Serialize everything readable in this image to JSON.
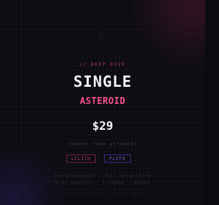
{
  "decor": {
    "moon_glyph": "☾"
  },
  "product": {
    "eyebrow": "// DEEP DIVE",
    "title": "SINGLE",
    "subtitle": "ASTEROID",
    "price": "$29",
    "choose_label": "CHOOSE YOUR ASTEROID",
    "options": [
      {
        "label": "LILITH",
        "accent": "#d0407a"
      },
      {
        "label": "PLUTO",
        "accent": "#7f6be0"
      }
    ],
    "features": [
      "One placement · full excavation",
      "Body aspects · Lineage · Wound"
    ],
    "footer": "DEEP STARSIGN · ASTRO DEEP"
  },
  "colors": {
    "background": "#0c0b10",
    "accent_pink": "#ff4f93",
    "accent_purple": "#7f6be0",
    "text": "#f4f1f7"
  }
}
